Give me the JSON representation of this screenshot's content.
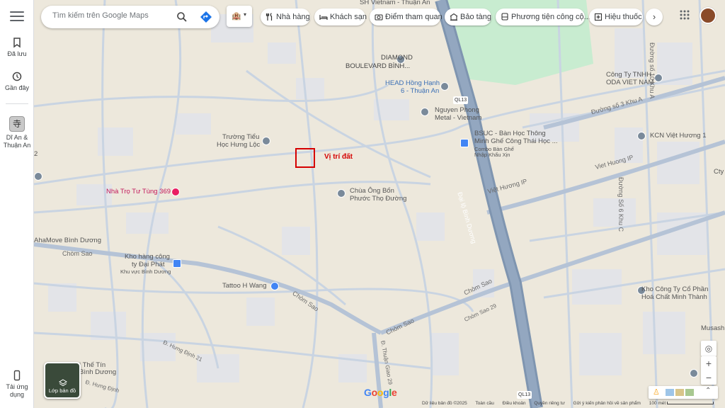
{
  "rail": {
    "saved": "Đã lưu",
    "recent": "Gần đây",
    "recent_place": "Dĩ An & Thuận An",
    "download_app": "Tải ứng dụng"
  },
  "search": {
    "placeholder": "Tìm kiếm trên Google Maps",
    "value": ""
  },
  "hotel_toggle": "🏨",
  "chips": [
    {
      "label": "Nhà hàng",
      "icon": "fork-knife-icon"
    },
    {
      "label": "Khách sạn",
      "icon": "bed-icon"
    },
    {
      "label": "Điểm tham quan",
      "icon": "camera-icon"
    },
    {
      "label": "Bảo tàng",
      "icon": "museum-icon"
    },
    {
      "label": "Phương tiện công cộ...",
      "icon": "bus-icon"
    },
    {
      "label": "Hiệu thuốc",
      "icon": "pharmacy-icon"
    }
  ],
  "map": {
    "marked_location": "Vị trí đất",
    "labels": {
      "diamond": "DIAMOND",
      "boulevard": "BOULEVARD BÌNH...",
      "sh_vietnam": "SH Vietnam - Thuận An",
      "head_honda_1": "HEAD Hồng Hạnh",
      "head_honda_2": "6 - Thuận An",
      "nguyen_phong_1": "Nguyen Phong",
      "nguyen_phong_2": "Metal - Vietnam",
      "bsuc_1": "BSUC - Bàn Học Thông",
      "bsuc_2": "Minh Ghế Công Thái Học ...",
      "bsuc_3": "Combo Bàn Ghế",
      "bsuc_4": "Nhập Khẩu Xịn",
      "oda_1": "Công Ty TNHH",
      "oda_2": "ODA VIET NAM",
      "kcn": "KCN Việt Hương 1",
      "truong_1": "Trường Tiểu",
      "truong_2": "Học Hưng Lộc",
      "chua_1": "Chùa Ông Bổn",
      "chua_2": "Phước Thọ Đường",
      "nha_tro": "Nhà Trọ Tư Tùng 369",
      "ahamove": "AhaMove Bình Dương",
      "kho_hang_1": "Kho hàng công",
      "kho_hang_2": "ty Đại Phát",
      "kho_hang_3": "Khu vực Bình Dương",
      "tattoo": "Tattoo H Wang",
      "kho_cty_1": "Kho Công Ty Cổ Phần",
      "kho_cty_2": "Hoá Chất Minh Thành",
      "the_tin_1": "ị Thế Tín",
      "the_tin_2": "Bình Dương",
      "city": "Cty",
      "musash": "Musash",
      "num2": "2"
    },
    "roads": {
      "dai_lo": "Đại lộ Bình Dương",
      "viet_huong_1": "Viet Huong IP",
      "viet_huong_2": "Việt Hương IP",
      "duong_so_3": "Đường số 3 Khu A",
      "duong_so_10": "Đường số 10 Khu A",
      "duong_so_6": "Đường Số 6 Khu C",
      "chom_sao_1": "Chòm Sao",
      "chom_sao_2": "Chòm Sao",
      "chom_sao_3": "Chòm Sao",
      "chom_sao_4": "Chòm Sao",
      "chom_sao_29": "Chòm Sao 29",
      "thuan_giao": "Đ. Thuận Giao 29",
      "hung_dinh_21": "Đ. Hưng Định 21",
      "hung_dinh": "Đ. Hưng Định",
      "ql13_top": "QL13",
      "ql13_bottom": "QL13"
    }
  },
  "controls": {
    "layers": "Lớp bản đồ",
    "zoom_in": "+",
    "zoom_out": "−"
  },
  "footer": {
    "data": "Dữ liệu bản đồ ©2025",
    "global": "Toàn cầu",
    "terms": "Điều khoản",
    "privacy": "Quyền riêng tư",
    "feedback": "Gửi ý kiến phản hồi về sản phẩm",
    "scale": "100 mét"
  },
  "google": "Google",
  "colors": {
    "map_bg": "#ede8dc",
    "highway": "#8fa3bd",
    "road": "#c6d2e0",
    "park": "#c8ecd0",
    "marker": "#d50000"
  }
}
